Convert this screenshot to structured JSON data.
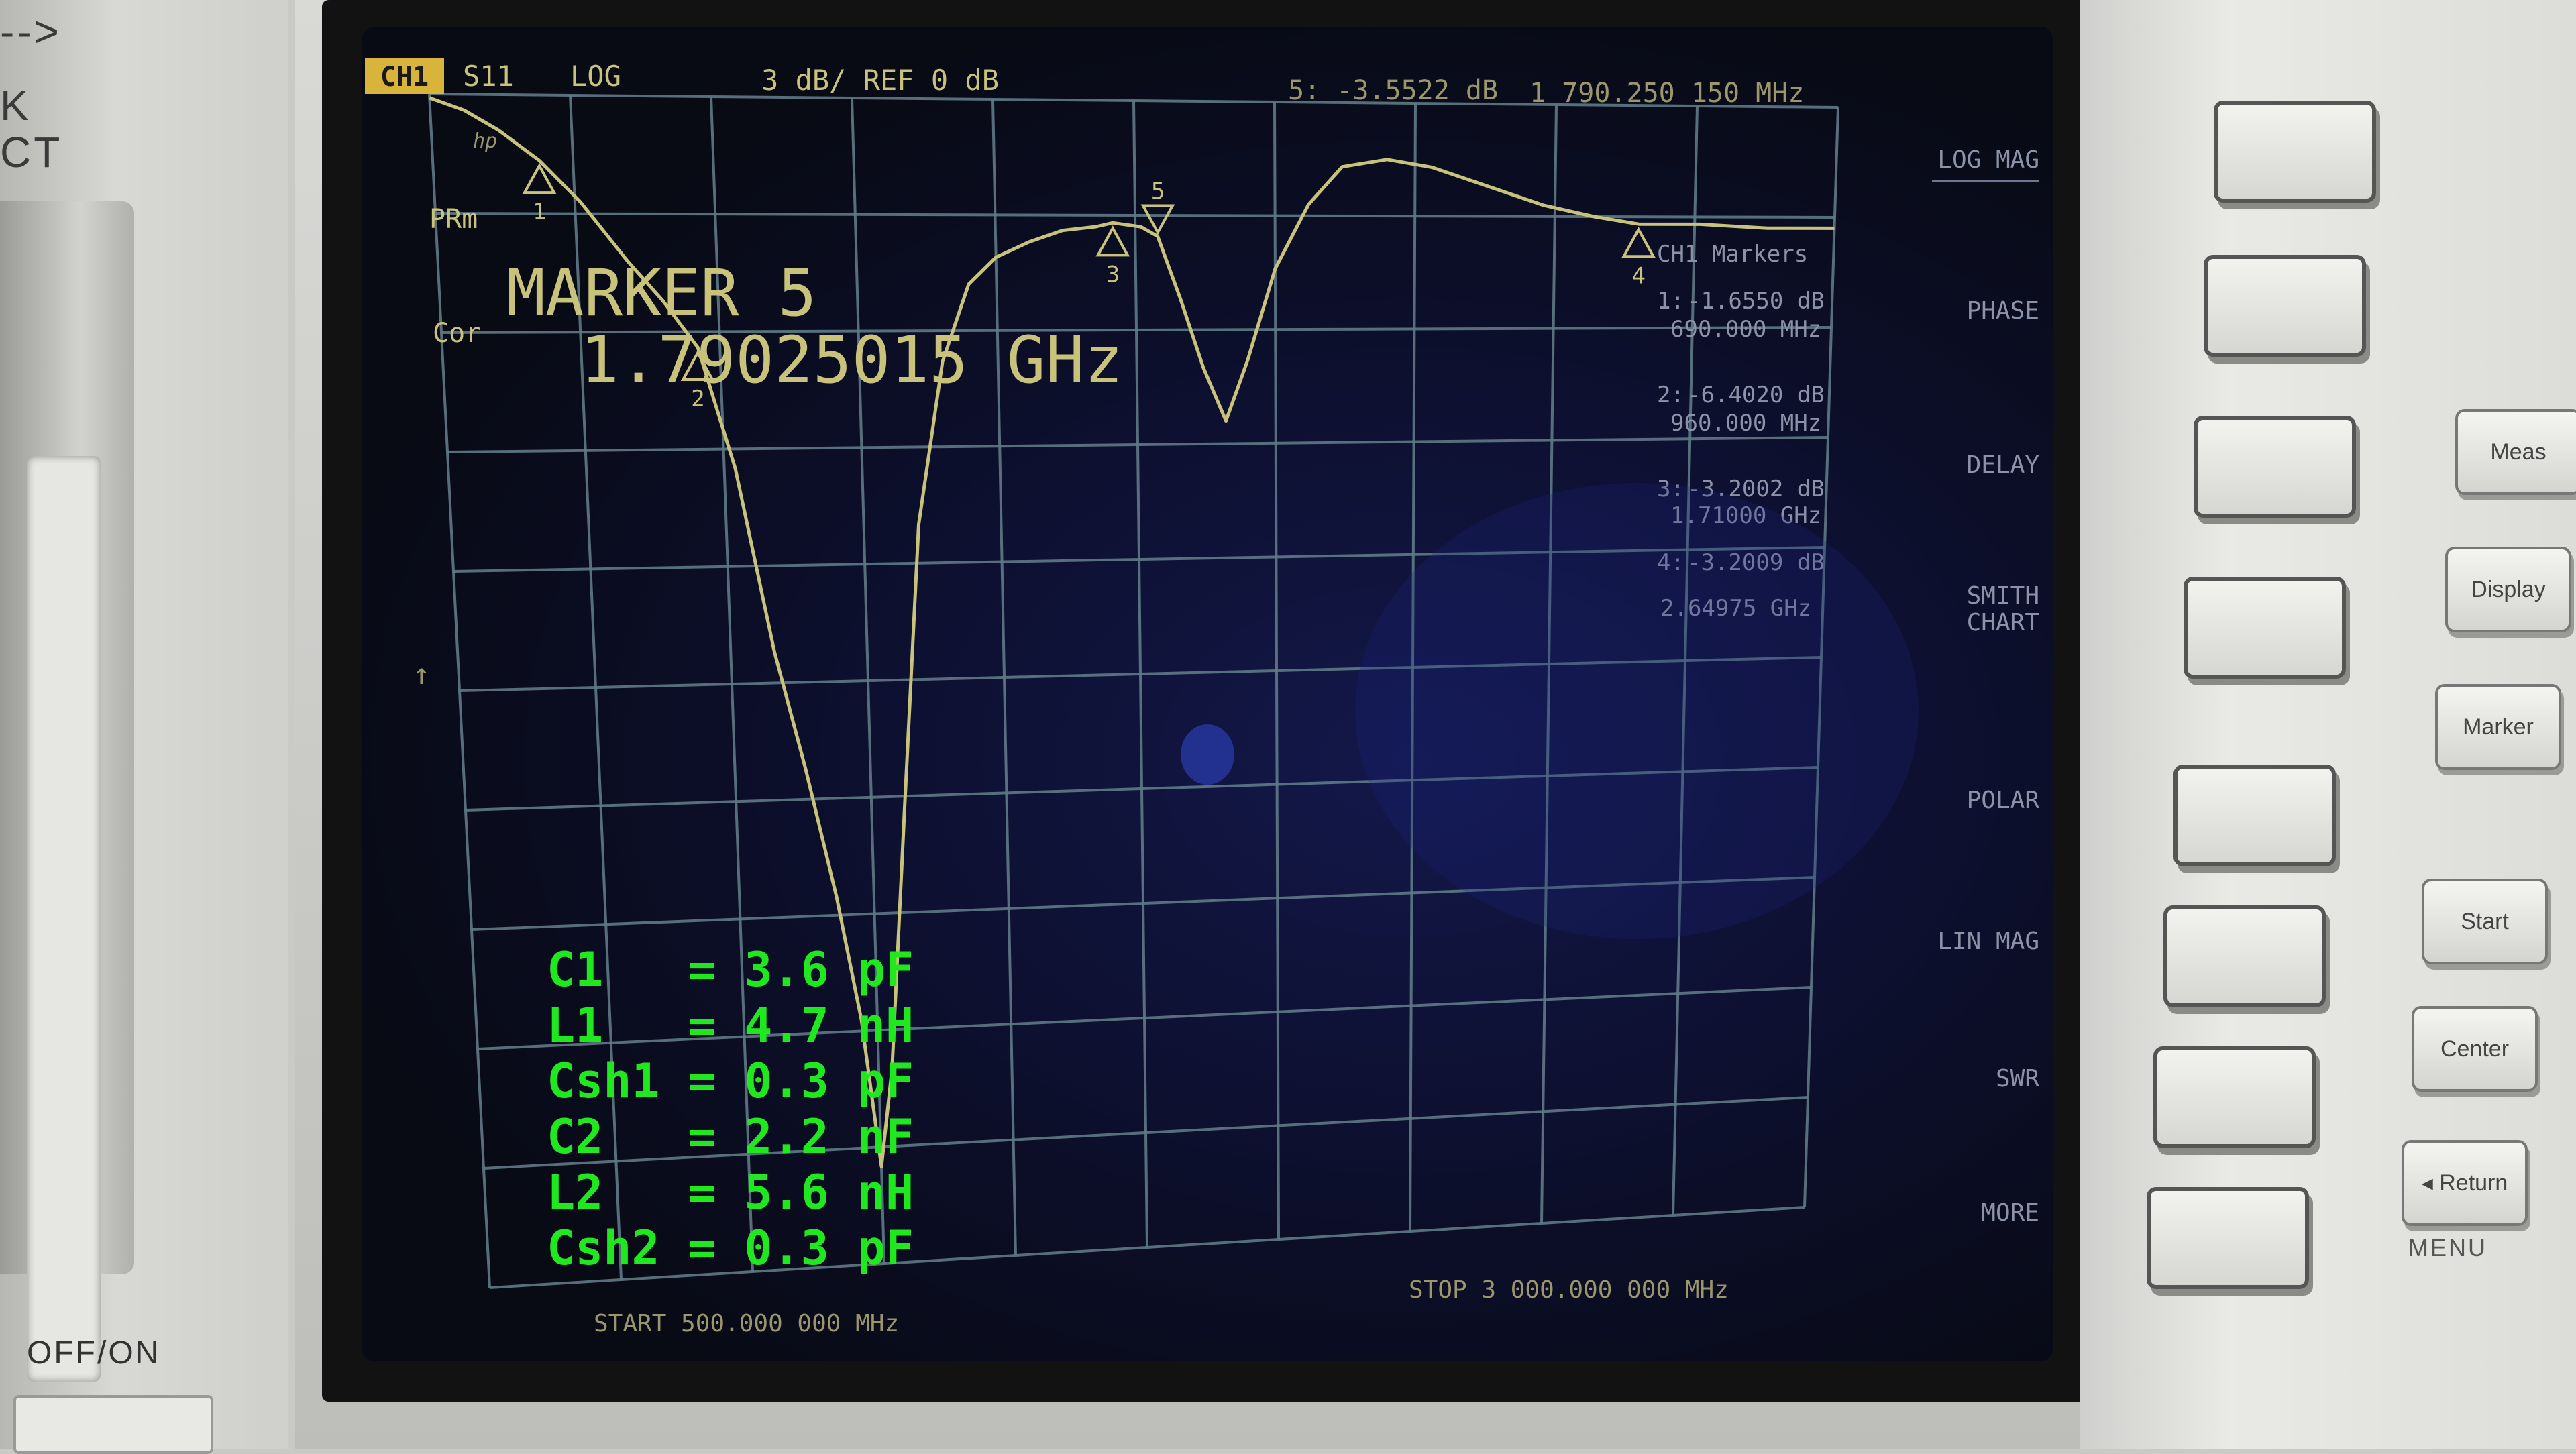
{
  "left_panel": {
    "arrow_text": "-->",
    "line1": "K",
    "line2": "CT",
    "power_label": "OFF/ON"
  },
  "header": {
    "channel_badge": "CH1",
    "parameter": "S11",
    "format": "LOG",
    "scale": "3 dB/ REF 0 dB",
    "active_marker_readout": "5: -3.5522 dB",
    "active_marker_freq": "1 790.250 150 MHz"
  },
  "left_annotations": {
    "prm": "PRm",
    "cor": "Cor",
    "trace_label": "hp"
  },
  "marker_display": {
    "title": "MARKER 5",
    "frequency": "1.79025015 GHz"
  },
  "marker_list": {
    "header": "CH1 Markers",
    "items": [
      {
        "label": "1:",
        "value": "-1.6550 dB",
        "freq": "690.000 MHz"
      },
      {
        "label": "2:",
        "value": "-6.4020 dB",
        "freq": "960.000 MHz"
      },
      {
        "label": "3:",
        "value": "-3.2002 dB",
        "freq": "1.71000 GHz"
      },
      {
        "label": "4:",
        "value": "-3.2009 dB",
        "freq": "2.64975 GHz"
      }
    ]
  },
  "softkeys": [
    {
      "label1": "LOG MAG",
      "label2": ""
    },
    {
      "label1": "PHASE",
      "label2": ""
    },
    {
      "label1": "DELAY",
      "label2": ""
    },
    {
      "label1": "SMITH",
      "label2": "CHART"
    },
    {
      "label1": "POLAR",
      "label2": ""
    },
    {
      "label1": "LIN MAG",
      "label2": ""
    },
    {
      "label1": "SWR",
      "label2": ""
    },
    {
      "label1": "MORE",
      "label2": ""
    }
  ],
  "footer": {
    "start": "START 500.000 000 MHz",
    "stop": "STOP 3 000.000 000 MHz"
  },
  "component_values": [
    {
      "name": "C1",
      "value": "= 3.6 pF"
    },
    {
      "name": "L1",
      "value": "= 4.7 nH"
    },
    {
      "name": "Csh1",
      "value": "= 0.3 pF"
    },
    {
      "name": "C2",
      "value": "= 2.2 nF"
    },
    {
      "name": "L2",
      "value": "= 5.6 nH"
    },
    {
      "name": "Csh2",
      "value": "= 0.3 pF"
    }
  ],
  "hard_keys": {
    "meas": "Meas",
    "display": "Display",
    "marker": "Marker",
    "start": "Start",
    "center": "Center",
    "return": "◂ Return",
    "menu": "MENU"
  },
  "marker_numbers": [
    "1",
    "2",
    "3",
    "4",
    "5"
  ],
  "colors": {
    "trace": "#c9c27a",
    "grid": "#5f7a86",
    "overlay_text": "#1fe81f"
  },
  "chart_data": {
    "type": "line",
    "parameter": "S11",
    "xlabel": "",
    "ylabel": "",
    "x_start_mhz": 500,
    "x_stop_mhz": 3000,
    "ylim": [
      -30,
      0
    ],
    "grid": true,
    "series": [
      {
        "name": "",
        "points_mhz_db": [
          [
            500,
            -0.1
          ],
          [
            560,
            -0.4
          ],
          [
            620,
            -0.9
          ],
          [
            690,
            -1.66
          ],
          [
            760,
            -2.7
          ],
          [
            840,
            -4.2
          ],
          [
            900,
            -5.2
          ],
          [
            960,
            -6.4
          ],
          [
            1020,
            -9.5
          ],
          [
            1080,
            -14.2
          ],
          [
            1130,
            -17.2
          ],
          [
            1180,
            -20.5
          ],
          [
            1220,
            -23.7
          ],
          [
            1250,
            -27.5
          ],
          [
            1275,
            -25.0
          ],
          [
            1310,
            -18.5
          ],
          [
            1350,
            -11.0
          ],
          [
            1400,
            -6.8
          ],
          [
            1450,
            -4.8
          ],
          [
            1500,
            -4.1
          ],
          [
            1560,
            -3.7
          ],
          [
            1620,
            -3.4
          ],
          [
            1680,
            -3.3
          ],
          [
            1710,
            -3.2
          ],
          [
            1760,
            -3.3
          ],
          [
            1790,
            -3.55
          ],
          [
            1830,
            -5.2
          ],
          [
            1870,
            -7.0
          ],
          [
            1910,
            -8.4
          ],
          [
            1950,
            -6.8
          ],
          [
            2000,
            -4.4
          ],
          [
            2060,
            -2.7
          ],
          [
            2120,
            -1.7
          ],
          [
            2200,
            -1.5
          ],
          [
            2280,
            -1.7
          ],
          [
            2380,
            -2.2
          ],
          [
            2480,
            -2.7
          ],
          [
            2570,
            -3.0
          ],
          [
            2650,
            -3.2
          ],
          [
            2760,
            -3.2
          ],
          [
            2880,
            -3.3
          ],
          [
            3000,
            -3.3
          ]
        ]
      }
    ],
    "markers": [
      {
        "n": 1,
        "mhz": 690,
        "db": -1.655
      },
      {
        "n": 2,
        "mhz": 960,
        "db": -6.402
      },
      {
        "n": 3,
        "mhz": 1710,
        "db": -3.2002
      },
      {
        "n": 4,
        "mhz": 2649.75,
        "db": -3.2009
      },
      {
        "n": 5,
        "mhz": 1790.25015,
        "db": -3.5522
      }
    ]
  }
}
